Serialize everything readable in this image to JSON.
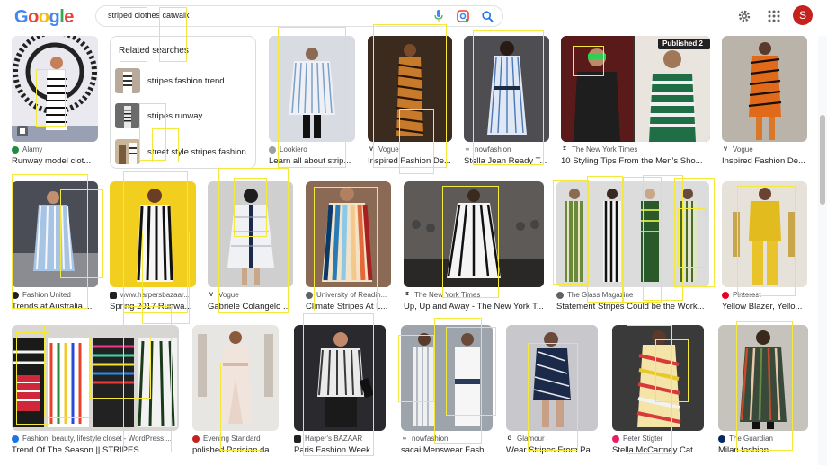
{
  "header": {
    "logo_letters": [
      {
        "ch": "G",
        "color": "#4285f4"
      },
      {
        "ch": "o",
        "color": "#ea4335"
      },
      {
        "ch": "o",
        "color": "#fbbc05"
      },
      {
        "ch": "g",
        "color": "#4285f4"
      },
      {
        "ch": "l",
        "color": "#34a853"
      },
      {
        "ch": "e",
        "color": "#ea4335"
      }
    ],
    "search_query": "striped clothes catwalk",
    "avatar_letter": "S",
    "icons": [
      "mic-icon",
      "lens-icon",
      "search-icon",
      "gear-icon",
      "apps-grid-icon"
    ]
  },
  "related": {
    "title": "Related searches",
    "items": [
      {
        "label": "stripes fashion trend"
      },
      {
        "label": "stripes runway"
      },
      {
        "label": "street style stripes fashion"
      }
    ]
  },
  "results": [
    {
      "source": "Alamy",
      "title": "Runway model clot...",
      "fav": "#1e8e3e"
    },
    {
      "source": "Lookiero",
      "title": "Learn all about strip...",
      "fav": "#9aa0a6"
    },
    {
      "source": "Vogue",
      "title": "Inspired Fashion De...",
      "fav": "#202124"
    },
    {
      "source": "nowfashion",
      "title": "Stella Jean Ready T...",
      "fav": "#5f6368"
    },
    {
      "source": "The New York Times",
      "title": "10 Styling Tips From the Men's Sho...",
      "fav": "#202124",
      "badge": "Published 2"
    },
    {
      "source": "Vogue",
      "title": "Inspired Fashion De...",
      "fav": "#202124"
    },
    {
      "source": "Fashion United",
      "title": "Trends at Australia ...",
      "fav": "#202124"
    },
    {
      "source": "www.harpersbazaar...",
      "title": "Spring 2017 Runwa...",
      "fav": "#202124"
    },
    {
      "source": "Vogue",
      "title": "Gabriele Colangelo ...",
      "fav": "#202124"
    },
    {
      "source": "University of Readin...",
      "title": "Climate Stripes At L...",
      "fav": "#5f6368"
    },
    {
      "source": "The New York Times",
      "title": "Up, Up and Away - The New York T...",
      "fav": "#202124"
    },
    {
      "source": "The Glass Magazine",
      "title": "Statement Stripes Could be the Work...",
      "fav": "#5f6368"
    },
    {
      "source": "Pinterest",
      "title": "Yellow Blazer, Yello...",
      "fav": "#e60023"
    },
    {
      "source": "Fashion, beauty, lifestyle closet - WordPress....",
      "title": "Trend Of The Season || STRIPES ...",
      "fav": "#1a73e8"
    },
    {
      "source": "Evening Standard",
      "title": "polished Parisian da...",
      "fav": "#c5221f"
    },
    {
      "source": "Harper's BAZAAR",
      "title": "Paris Fashion Week R...",
      "fav": "#202124"
    },
    {
      "source": "nowfashion",
      "title": "sacai Menswear Fash...",
      "fav": "#5f6368"
    },
    {
      "source": "Glamour",
      "title": "Wear Stripes From Pa...",
      "fav": "#202124"
    },
    {
      "source": "Peter Stigter",
      "title": "Stella McCartney Cat...",
      "fav": "#e91e63"
    },
    {
      "source": "The Guardian",
      "title": "Milan fashion ...",
      "fav": "#052962"
    }
  ]
}
